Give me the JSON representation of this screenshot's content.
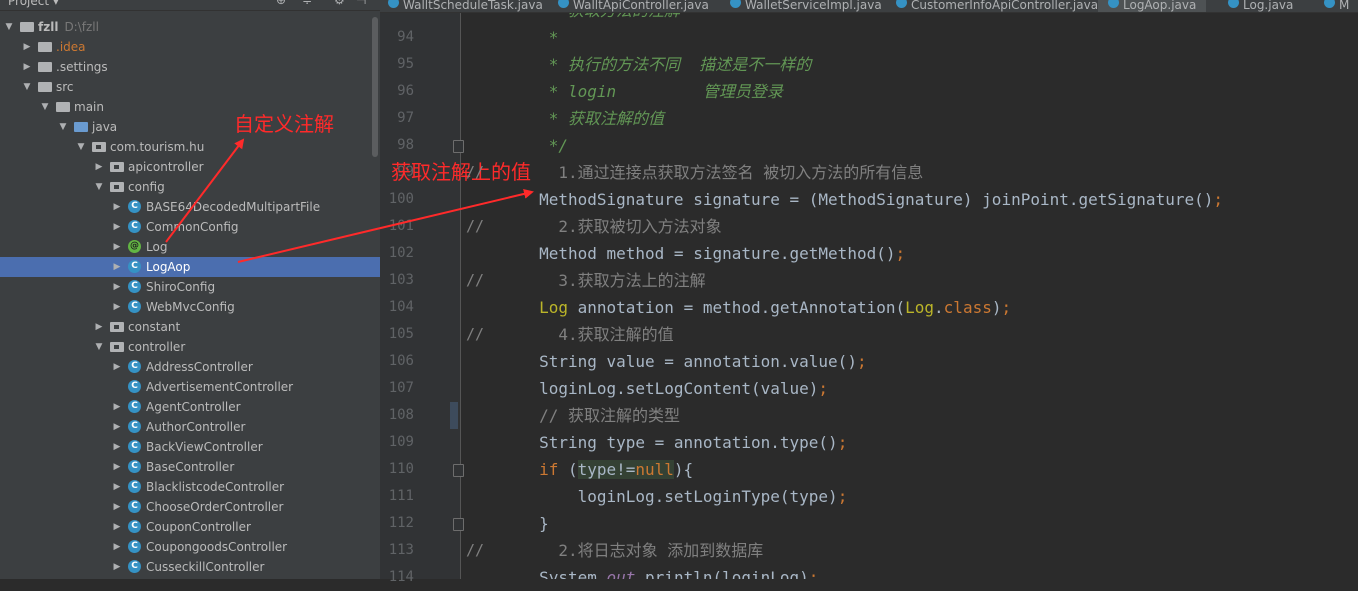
{
  "project_panel": {
    "title": "Project ▾",
    "tree": [
      {
        "label": "fzll",
        "hint": "D:\\fzll",
        "indent": 0,
        "arrow": "down",
        "icon": "module-folder",
        "bold": true
      },
      {
        "label": ".idea",
        "indent": 1,
        "arrow": "right",
        "icon": "folder",
        "color": "orange"
      },
      {
        "label": ".settings",
        "indent": 1,
        "arrow": "right",
        "icon": "folder"
      },
      {
        "label": "src",
        "indent": 1,
        "arrow": "down",
        "icon": "folder"
      },
      {
        "label": "main",
        "indent": 2,
        "arrow": "down",
        "icon": "folder"
      },
      {
        "label": "java",
        "indent": 3,
        "arrow": "down",
        "icon": "source-folder"
      },
      {
        "label": "com.tourism.hu",
        "indent": 4,
        "arrow": "down",
        "icon": "package"
      },
      {
        "label": "apicontroller",
        "indent": 5,
        "arrow": "right",
        "icon": "package"
      },
      {
        "label": "config",
        "indent": 5,
        "arrow": "down",
        "icon": "package"
      },
      {
        "label": "BASE64DecodedMultipartFile",
        "indent": 6,
        "arrow": "right",
        "icon": "class"
      },
      {
        "label": "CommonConfig",
        "indent": 6,
        "arrow": "right",
        "icon": "class"
      },
      {
        "label": "Log",
        "indent": 6,
        "arrow": "right",
        "icon": "annotation"
      },
      {
        "label": "LogAop",
        "indent": 6,
        "arrow": "right",
        "icon": "class",
        "selected": true
      },
      {
        "label": "ShiroConfig",
        "indent": 6,
        "arrow": "right",
        "icon": "class"
      },
      {
        "label": "WebMvcConfig",
        "indent": 6,
        "arrow": "right",
        "icon": "class"
      },
      {
        "label": "constant",
        "indent": 5,
        "arrow": "right",
        "icon": "package"
      },
      {
        "label": "controller",
        "indent": 5,
        "arrow": "down",
        "icon": "package"
      },
      {
        "label": "AddressController",
        "indent": 6,
        "arrow": "right",
        "icon": "class"
      },
      {
        "label": "AdvertisementController",
        "indent": 6,
        "arrow": "none",
        "icon": "class"
      },
      {
        "label": "AgentController",
        "indent": 6,
        "arrow": "right",
        "icon": "class"
      },
      {
        "label": "AuthorController",
        "indent": 6,
        "arrow": "right",
        "icon": "class"
      },
      {
        "label": "BackViewController",
        "indent": 6,
        "arrow": "right",
        "icon": "class"
      },
      {
        "label": "BaseController",
        "indent": 6,
        "arrow": "right",
        "icon": "class"
      },
      {
        "label": "BlacklistcodeController",
        "indent": 6,
        "arrow": "right",
        "icon": "class"
      },
      {
        "label": "ChooseOrderController",
        "indent": 6,
        "arrow": "right",
        "icon": "class"
      },
      {
        "label": "CouponController",
        "indent": 6,
        "arrow": "right",
        "icon": "class"
      },
      {
        "label": "CoupongoodsController",
        "indent": 6,
        "arrow": "right",
        "icon": "class"
      },
      {
        "label": "CusseckillController",
        "indent": 6,
        "arrow": "right",
        "icon": "class"
      }
    ]
  },
  "tabs": [
    {
      "label": "WalltScheduleTask.java"
    },
    {
      "label": "WalltApiController.java"
    },
    {
      "label": "WalletServiceImpl.java"
    },
    {
      "label": "CustomerInfoApiController.java"
    },
    {
      "label": "LogAop.java",
      "active": true
    },
    {
      "label": "Log.java"
    },
    {
      "label": "M"
    }
  ],
  "editor": {
    "lines": [
      {
        "no": "94",
        "gutter": "",
        "tokens": [
          {
            "t": "         *",
            "c": "doc"
          }
        ]
      },
      {
        "no": "95",
        "gutter": "",
        "tokens": [
          {
            "t": "         * 执行的方法不同  描述是不一样的",
            "c": "doc"
          }
        ]
      },
      {
        "no": "96",
        "gutter": "",
        "tokens": [
          {
            "t": "         * login         管理员登录",
            "c": "doc"
          }
        ]
      },
      {
        "no": "97",
        "gutter": "",
        "tokens": [
          {
            "t": "         * 获取注解的值",
            "c": "doc"
          }
        ]
      },
      {
        "no": "98",
        "gutter": "",
        "tokens": [
          {
            "t": "         */",
            "c": "doc"
          }
        ]
      },
      {
        "no": "99",
        "gutter": "//",
        "tokens": [
          {
            "t": "          1.通过连接点获取方法签名 被切入方法的所有信息",
            "c": "com"
          }
        ]
      },
      {
        "no": "100",
        "gutter": "",
        "tokens": [
          {
            "t": "        MethodSignature signature = (MethodSignature) joinPoint.getSignature()",
            "c": "plain"
          },
          {
            "t": ";",
            "c": "kw"
          }
        ]
      },
      {
        "no": "101",
        "gutter": "//",
        "tokens": [
          {
            "t": "          2.获取被切入方法对象",
            "c": "com"
          }
        ]
      },
      {
        "no": "102",
        "gutter": "",
        "tokens": [
          {
            "t": "        Method method = signature.getMethod()",
            "c": "plain"
          },
          {
            "t": ";",
            "c": "kw"
          }
        ]
      },
      {
        "no": "103",
        "gutter": "//",
        "tokens": [
          {
            "t": "          3.获取方法上的注解",
            "c": "com"
          }
        ]
      },
      {
        "no": "104",
        "gutter": "",
        "tokens": [
          {
            "t": "        ",
            "c": "plain"
          },
          {
            "t": "Log",
            "c": "ann"
          },
          {
            "t": " annotation = method.getAnnotation(",
            "c": "plain"
          },
          {
            "t": "Log",
            "c": "ann"
          },
          {
            "t": ".",
            "c": "plain"
          },
          {
            "t": "class",
            "c": "kw"
          },
          {
            "t": ")",
            "c": "plain"
          },
          {
            "t": ";",
            "c": "kw"
          }
        ]
      },
      {
        "no": "105",
        "gutter": "//",
        "tokens": [
          {
            "t": "          4.获取注解的值",
            "c": "com"
          }
        ]
      },
      {
        "no": "106",
        "gutter": "",
        "tokens": [
          {
            "t": "        String value = annotation.value()",
            "c": "plain"
          },
          {
            "t": ";",
            "c": "kw"
          }
        ]
      },
      {
        "no": "107",
        "gutter": "",
        "tokens": [
          {
            "t": "        loginLog.setLogContent(value)",
            "c": "plain"
          },
          {
            "t": ";",
            "c": "kw"
          }
        ]
      },
      {
        "no": "108",
        "gutter": "",
        "tokens": [
          {
            "t": "        // 获取注解的类型",
            "c": "com"
          }
        ]
      },
      {
        "no": "109",
        "gutter": "",
        "tokens": [
          {
            "t": "        String type = annotation.type()",
            "c": "plain"
          },
          {
            "t": ";",
            "c": "kw"
          }
        ]
      },
      {
        "no": "110",
        "gutter": "",
        "tokens": [
          {
            "t": "        ",
            "c": "plain"
          },
          {
            "t": "if",
            "c": "kw"
          },
          {
            "t": " (",
            "c": "plain"
          },
          {
            "t": "type!=",
            "c": "hl"
          },
          {
            "t": "null",
            "c": "kwhl"
          },
          {
            "t": "){",
            "c": "plain"
          }
        ]
      },
      {
        "no": "111",
        "gutter": "",
        "tokens": [
          {
            "t": "            loginLog.setLoginType(type)",
            "c": "plain"
          },
          {
            "t": ";",
            "c": "kw"
          }
        ]
      },
      {
        "no": "112",
        "gutter": "",
        "tokens": [
          {
            "t": "        }",
            "c": "plain"
          }
        ]
      },
      {
        "no": "113",
        "gutter": "//",
        "tokens": [
          {
            "t": "          2.将日志对象 添加到数据库",
            "c": "com"
          }
        ]
      },
      {
        "no": "114",
        "gutter": "",
        "tokens": [
          {
            "t": "        System.",
            "c": "plain"
          },
          {
            "t": "out",
            "c": "fld"
          },
          {
            "t": ".println(loginLog)",
            "c": "plain"
          },
          {
            "t": ";",
            "c": "kw"
          }
        ]
      }
    ],
    "top_partial": "         * 获取方法的注解"
  },
  "annotations": {
    "custom_annotation_label": "自定义注解",
    "get_value_label": "获取注解上的值",
    "color": "#ff2a2a"
  }
}
